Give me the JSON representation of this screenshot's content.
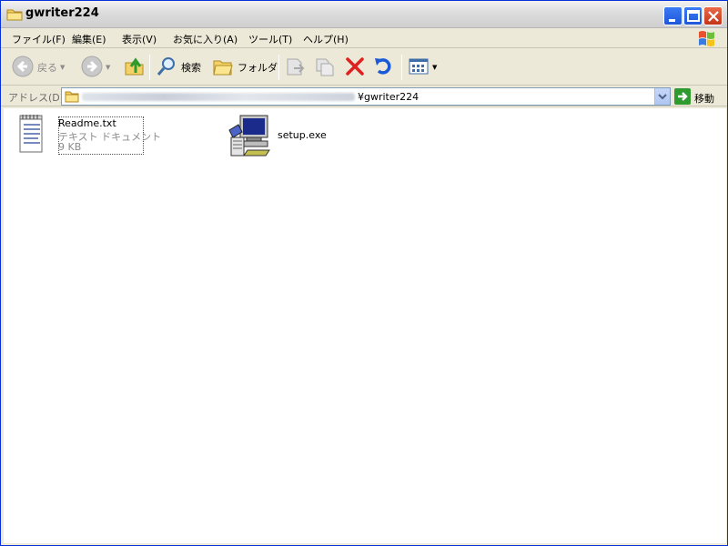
{
  "window": {
    "title": "gwriter224"
  },
  "menu": [
    {
      "label": "ファイル(F)"
    },
    {
      "label": "編集(E)"
    },
    {
      "label": "表示(V)"
    },
    {
      "label": "お気に入り(A)"
    },
    {
      "label": "ツール(T)"
    },
    {
      "label": "ヘルプ(H)"
    }
  ],
  "toolbar": {
    "back_label": "戻る",
    "search_label": "検索",
    "folders_label": "フォルダ"
  },
  "address": {
    "label": "アドレス(D)",
    "path_visible_tail": "¥gwriter224",
    "go_label": "移動"
  },
  "files": [
    {
      "name": "Readme.txt",
      "type": "テキスト ドキュメント",
      "size": "9 KB",
      "icon": "text-document-icon"
    },
    {
      "name": "setup.exe",
      "icon": "installer-icon"
    }
  ],
  "colors": {
    "title_close": "#c43418",
    "title_buttons": "#1f56d8",
    "go_arrow": "#2f9a2f",
    "delete_x": "#e02020",
    "undo_arrow": "#1a5ad8"
  }
}
